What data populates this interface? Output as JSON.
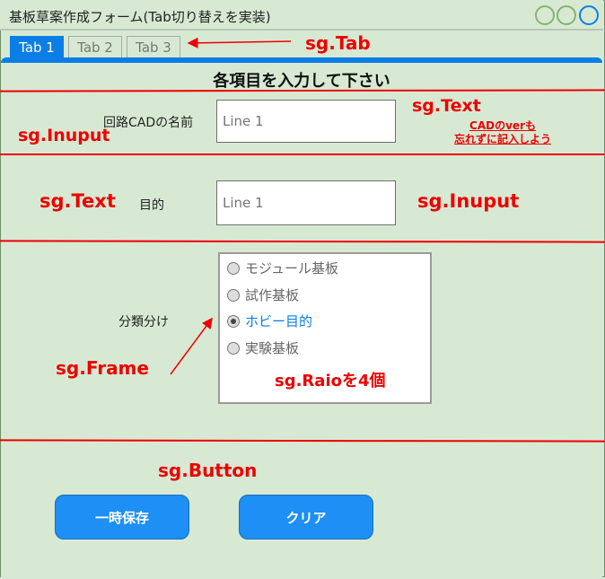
{
  "window": {
    "title": "基板草案作成フォーム(Tab切り替えを実装)"
  },
  "tabs": [
    {
      "label": "Tab 1",
      "active": true
    },
    {
      "label": "Tab 2",
      "active": false
    },
    {
      "label": "Tab 3",
      "active": false
    }
  ],
  "form": {
    "heading": "各項目を入力して下さい",
    "cad_name_label": "回路CADの名前",
    "cad_name_placeholder": "Line 1",
    "purpose_label": "目的",
    "purpose_placeholder": "Line 1",
    "classification_label": "分類分け",
    "radio_options": [
      {
        "label": "モジュール基板",
        "selected": false
      },
      {
        "label": "試作基板",
        "selected": false
      },
      {
        "label": "ホビー目的",
        "selected": true
      },
      {
        "label": "実験基板",
        "selected": false
      }
    ],
    "buttons": {
      "save": "一時保存",
      "clear": "クリア"
    }
  },
  "annotations": {
    "tab": "sg.Tab",
    "text1": "sg.Text",
    "input1": "sg.Inuput",
    "cad_note_line1": "CADのverも",
    "cad_note_line2": "忘れずに記入しよう",
    "text2": "sg.Text",
    "input2": "sg.Inuput",
    "frame": "sg.Frame",
    "radio": "sg.Raioを4個",
    "button": "sg.Button"
  },
  "colors": {
    "accent": "#0b7ee6",
    "annotation": "#ee0000",
    "background": "#d7e9d3"
  }
}
